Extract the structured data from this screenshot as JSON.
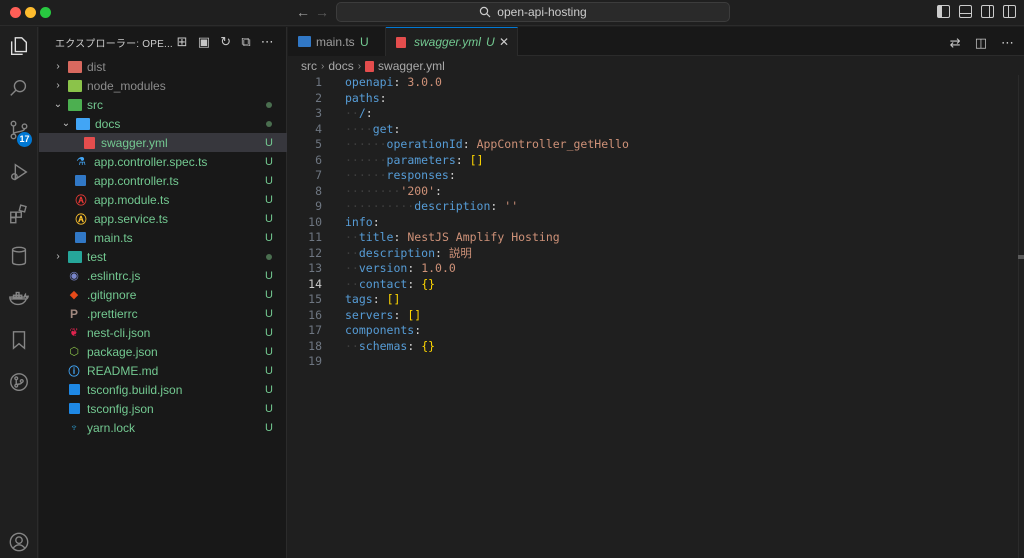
{
  "window": {
    "search_title": "open-api-hosting"
  },
  "activity_bar": {
    "scm_badge": "17"
  },
  "explorer": {
    "title": "エクスプローラー: OPE...",
    "items": [
      {
        "label": "dist",
        "type": "folder",
        "status": ""
      },
      {
        "label": "node_modules",
        "type": "folder",
        "status": ""
      },
      {
        "label": "src",
        "type": "folder",
        "status": "dot"
      },
      {
        "label": "docs",
        "type": "folder",
        "status": "dot"
      },
      {
        "label": "swagger.yml",
        "type": "yaml",
        "status": "U"
      },
      {
        "label": "app.controller.spec.ts",
        "type": "test",
        "status": "U"
      },
      {
        "label": "app.controller.ts",
        "type": "ts",
        "status": "U"
      },
      {
        "label": "app.module.ts",
        "type": "angular",
        "status": "U"
      },
      {
        "label": "app.service.ts",
        "type": "service",
        "status": "U"
      },
      {
        "label": "main.ts",
        "type": "ts",
        "status": "U"
      },
      {
        "label": "test",
        "type": "folder",
        "status": "dot"
      },
      {
        "label": ".eslintrc.js",
        "type": "eslint",
        "status": "U"
      },
      {
        "label": ".gitignore",
        "type": "git",
        "status": "U"
      },
      {
        "label": ".prettierrc",
        "type": "prettier",
        "status": "U"
      },
      {
        "label": "nest-cli.json",
        "type": "nest",
        "status": "U"
      },
      {
        "label": "package.json",
        "type": "node",
        "status": "U"
      },
      {
        "label": "README.md",
        "type": "info",
        "status": "U"
      },
      {
        "label": "tsconfig.build.json",
        "type": "tsconfig",
        "status": "U"
      },
      {
        "label": "tsconfig.json",
        "type": "tsconfig",
        "status": "U"
      },
      {
        "label": "yarn.lock",
        "type": "yarn",
        "status": "U"
      }
    ]
  },
  "tabs": [
    {
      "label": "main.ts",
      "status": "U"
    },
    {
      "label": "swagger.yml",
      "status": "U"
    }
  ],
  "breadcrumb": [
    "src",
    "docs",
    "swagger.yml"
  ],
  "code": {
    "current_line": 14,
    "lines": [
      {
        "n": "1",
        "key": "openapi",
        "val": "3.0.0"
      },
      {
        "n": "2",
        "key": "paths",
        "val": ""
      },
      {
        "n": "3",
        "key": "/",
        "val": ""
      },
      {
        "n": "4",
        "key": "get",
        "val": ""
      },
      {
        "n": "5",
        "key": "operationId",
        "val": "AppController_getHello"
      },
      {
        "n": "6",
        "key": "parameters",
        "val": "[]"
      },
      {
        "n": "7",
        "key": "responses",
        "val": ""
      },
      {
        "n": "8",
        "key": "'200'",
        "val": ""
      },
      {
        "n": "9",
        "key": "description",
        "val": "''"
      },
      {
        "n": "10",
        "key": "info",
        "val": ""
      },
      {
        "n": "11",
        "key": "title",
        "val": "NestJS Amplify Hosting"
      },
      {
        "n": "12",
        "key": "description",
        "val": "説明"
      },
      {
        "n": "13",
        "key": "version",
        "val": "1.0.0"
      },
      {
        "n": "14",
        "key": "contact",
        "val": "{}"
      },
      {
        "n": "15",
        "key": "tags",
        "val": "[]"
      },
      {
        "n": "16",
        "key": "servers",
        "val": "[]"
      },
      {
        "n": "17",
        "key": "components",
        "val": ""
      },
      {
        "n": "18",
        "key": "schemas",
        "val": "{}"
      },
      {
        "n": "19",
        "key": "",
        "val": ""
      }
    ]
  }
}
